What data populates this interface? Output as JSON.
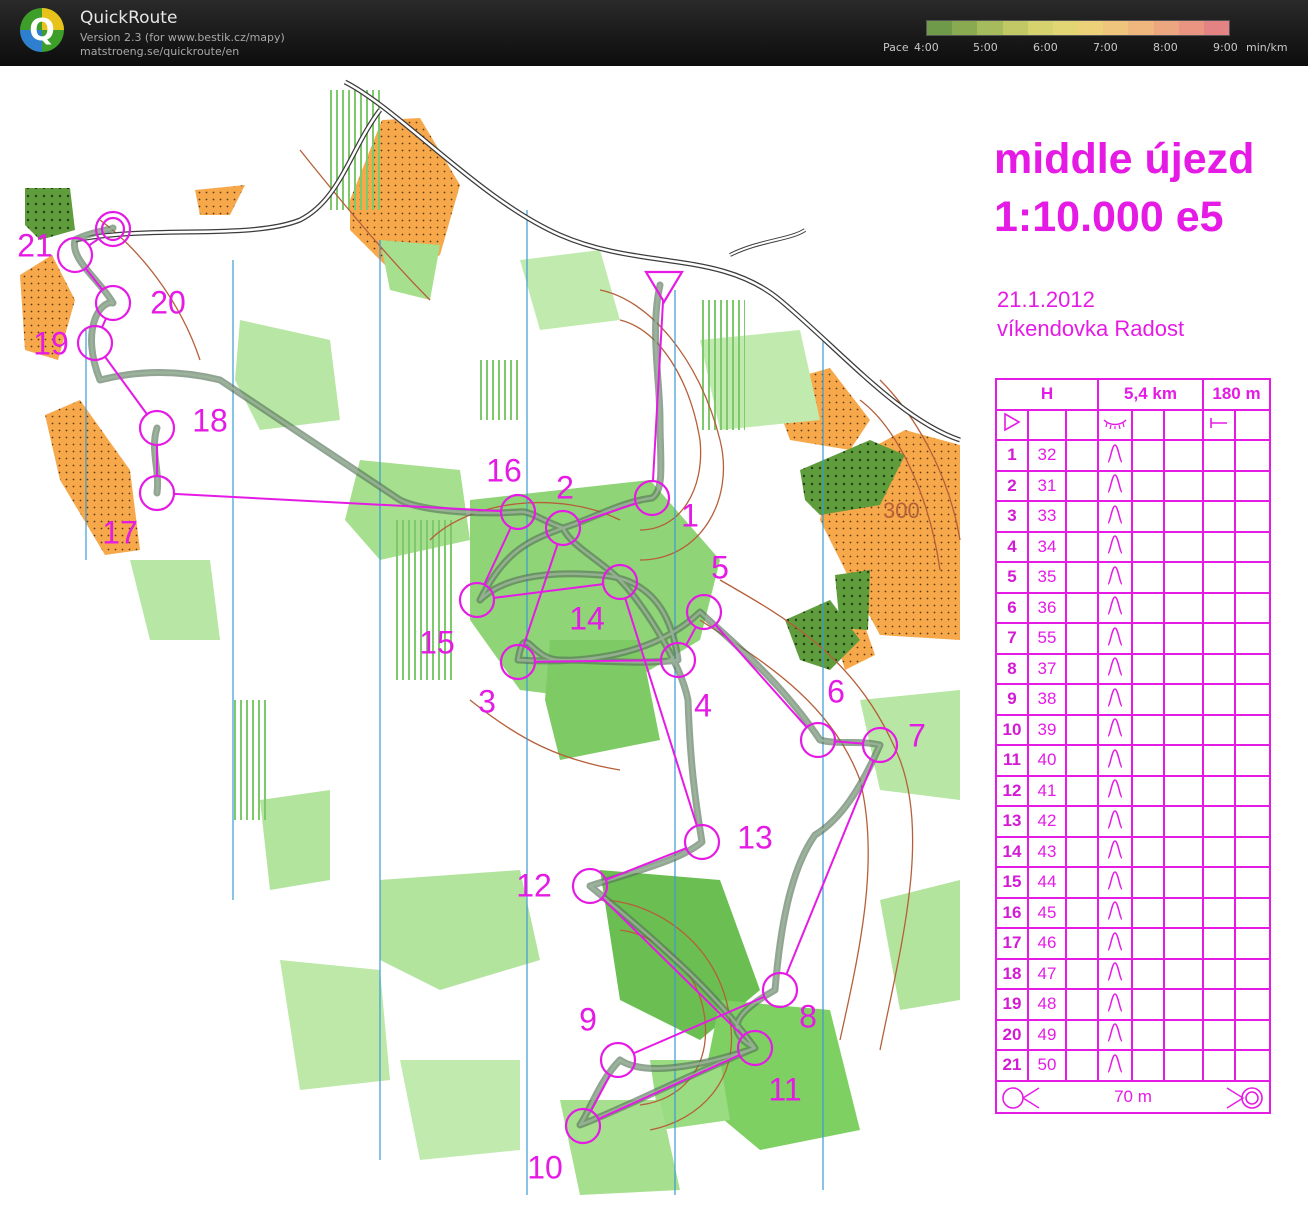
{
  "app": {
    "title": "QuickRoute",
    "version": "Version 2.3  (for www.bestik.cz/mapy)",
    "url": "matstroeng.se/quickroute/en",
    "logo_letter": "Q"
  },
  "pace_scale": {
    "label": "Pace",
    "ticks": [
      "4:00",
      "5:00",
      "6:00",
      "7:00",
      "8:00",
      "9:00"
    ],
    "unit": "min/km",
    "colors": [
      "#6f9a4a",
      "#8aaa52",
      "#a6bb5c",
      "#c1c865",
      "#d6d36f",
      "#e2d574",
      "#ecd07a",
      "#efc47c",
      "#efb67e",
      "#eda780",
      "#e99582",
      "#e48384"
    ]
  },
  "map": {
    "title_line1": "middle újezd",
    "title_line2": "1:10.000 e5",
    "date": "21.1.2012",
    "event": "víkendovka Radost",
    "contour_label": "300",
    "course_color": "#e51be5",
    "controls": [
      {
        "label": "1"
      },
      {
        "label": "2"
      },
      {
        "label": "3"
      },
      {
        "label": "4"
      },
      {
        "label": "5"
      },
      {
        "label": "6"
      },
      {
        "label": "7"
      },
      {
        "label": "8"
      },
      {
        "label": "9"
      },
      {
        "label": "10"
      },
      {
        "label": "11"
      },
      {
        "label": "12"
      },
      {
        "label": "13"
      },
      {
        "label": "14"
      },
      {
        "label": "15"
      },
      {
        "label": "16"
      },
      {
        "label": "17"
      },
      {
        "label": "18"
      },
      {
        "label": "19"
      },
      {
        "label": "20"
      },
      {
        "label": "21"
      }
    ]
  },
  "description_sheet": {
    "header": {
      "class": "H",
      "length": "5,4 km",
      "climb": "180 m"
    },
    "rows": [
      {
        "num": "1",
        "code": "32"
      },
      {
        "num": "2",
        "code": "31"
      },
      {
        "num": "3",
        "code": "33"
      },
      {
        "num": "4",
        "code": "34"
      },
      {
        "num": "5",
        "code": "35"
      },
      {
        "num": "6",
        "code": "36"
      },
      {
        "num": "7",
        "code": "55"
      },
      {
        "num": "8",
        "code": "37"
      },
      {
        "num": "9",
        "code": "38"
      },
      {
        "num": "10",
        "code": "39"
      },
      {
        "num": "11",
        "code": "40"
      },
      {
        "num": "12",
        "code": "41"
      },
      {
        "num": "13",
        "code": "42"
      },
      {
        "num": "14",
        "code": "43"
      },
      {
        "num": "15",
        "code": "44"
      },
      {
        "num": "16",
        "code": "45"
      },
      {
        "num": "17",
        "code": "46"
      },
      {
        "num": "18",
        "code": "47"
      },
      {
        "num": "19",
        "code": "48"
      },
      {
        "num": "20",
        "code": "49"
      },
      {
        "num": "21",
        "code": "50"
      }
    ],
    "finish_distance": "70 m"
  }
}
